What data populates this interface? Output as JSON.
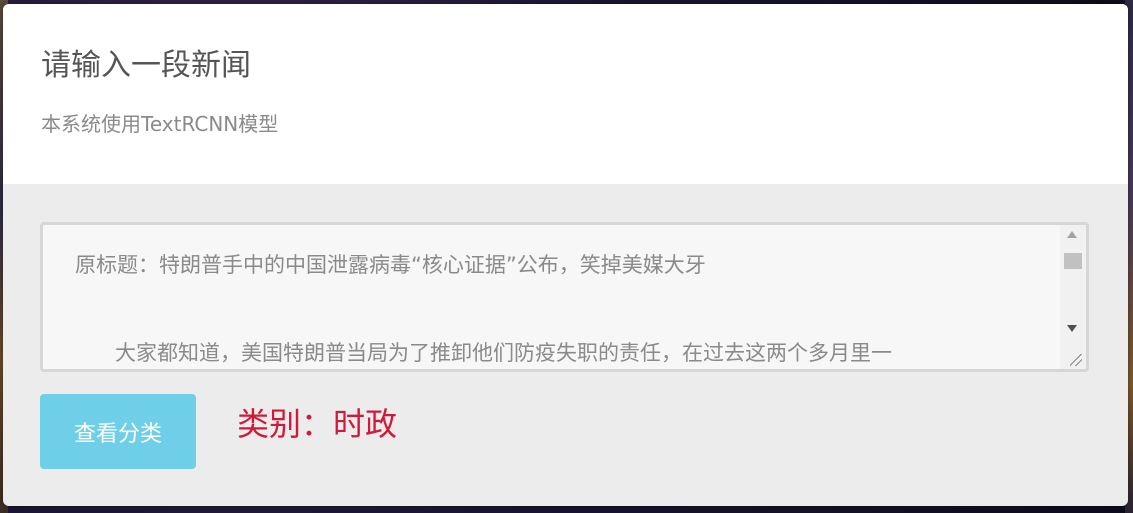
{
  "header": {
    "title": "请输入一段新闻",
    "subtitle": "本系统使用TextRCNN模型"
  },
  "news_input": {
    "lines": [
      "原标题：特朗普手中的中国泄露病毒“核心证据”公布，笑掉美媒大牙",
      "",
      "      大家都知道，美国特朗普当局为了推卸他们防疫失职的责任，在过去这两个多月里一"
    ]
  },
  "actions": {
    "classify_label": "查看分类"
  },
  "result": {
    "text": "类别：时政"
  },
  "colors": {
    "button_bg": "#6fcfe8",
    "result_text": "#d11a3a"
  }
}
